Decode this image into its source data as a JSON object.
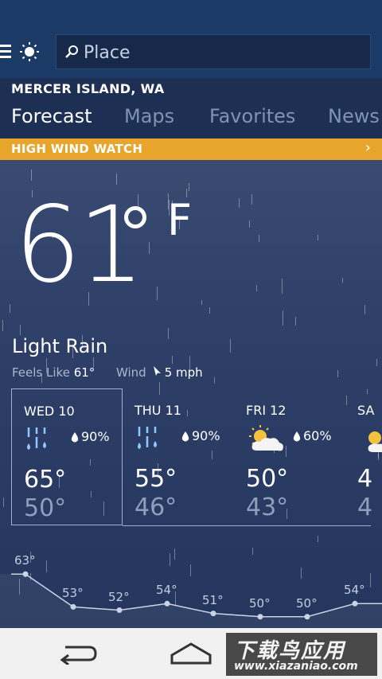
{
  "header": {
    "search_placeholder": "Place",
    "location": "MERCER ISLAND, WA",
    "tabs": [
      {
        "label": "Forecast",
        "active": true
      },
      {
        "label": "Maps",
        "active": false
      },
      {
        "label": "Favorites",
        "active": false
      },
      {
        "label": "News",
        "active": false
      }
    ]
  },
  "alert": {
    "text": "HIGH WIND WATCH",
    "chevron": "›"
  },
  "current": {
    "temp": "61",
    "unit": "F",
    "condition": "Light Rain",
    "feels_like_label": "Feels Like",
    "feels_like_value": "61°",
    "wind_label": "Wind",
    "wind_value": "5 mph"
  },
  "forecast": [
    {
      "day": "WED 10",
      "precip": "90%",
      "hi": "65°",
      "lo": "50°",
      "icon": "rain-icon"
    },
    {
      "day": "THU 11",
      "precip": "90%",
      "hi": "55°",
      "lo": "46°",
      "icon": "rain-icon"
    },
    {
      "day": "FRI 12",
      "precip": "60%",
      "hi": "50°",
      "lo": "43°",
      "icon": "partly-cloudy-icon"
    },
    {
      "day": "SA",
      "precip": "",
      "hi": "4",
      "lo": "4",
      "icon": "sun-icon"
    }
  ],
  "hourly_graph": {
    "values": [
      63,
      53,
      52,
      54,
      51,
      50,
      50,
      54
    ],
    "labels": [
      "63°",
      "53°",
      "52°",
      "54°",
      "51°",
      "50°",
      "50°",
      "54°"
    ]
  },
  "watermark": {
    "top": "下载鸟应用",
    "bottom": "www.xiazaniao.com"
  },
  "colors": {
    "topbar": "#1c3a66",
    "alert": "#e7a52c",
    "navbar": "#f1f1f1"
  }
}
